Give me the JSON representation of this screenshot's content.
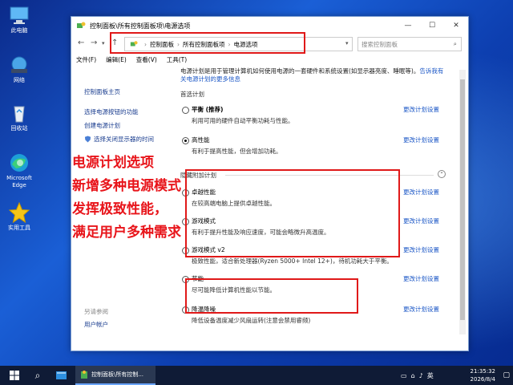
{
  "desktop": {
    "icons": [
      {
        "label": "此电脑"
      },
      {
        "label": "网络"
      },
      {
        "label": "回收站"
      },
      {
        "label": "Microsoft Edge"
      },
      {
        "label": "实用工具"
      }
    ]
  },
  "window": {
    "title": "控制面板\\所有控制面板项\\电源选项",
    "breadcrumb": [
      "控制面板",
      "所有控制面板项",
      "电源选项"
    ],
    "search_placeholder": "搜索控制面板",
    "menu": [
      "文件(F)",
      "编辑(E)",
      "查看(V)",
      "工具(T)"
    ],
    "sidebar": {
      "home": "控制面板主页",
      "items": [
        "选择电源按钮的功能",
        "创建电源计划",
        "选择关闭显示器的时间"
      ],
      "see_also": "另请参阅",
      "user_accounts": "用户帐户"
    },
    "intro_text": "电源计划是用于管理计算机如何使用电源的一套硬件和系统设置(如显示器亮度、睡眠等)。",
    "intro_link_1": "告诉我有",
    "intro_link_2": "关电源计划的更多信息",
    "preferred_heading": "首选计划",
    "hidden_heading": "隐藏附加计划",
    "change_label": "更改计划设置",
    "preferred_plans": [
      {
        "name": "平衡 (推荐)",
        "desc": "利用可用的硬件自动平衡功耗与性能。",
        "selected": false
      },
      {
        "name": "高性能",
        "desc": "有利于提高性能，但会增加功耗。",
        "selected": true
      }
    ],
    "hidden_plans": [
      {
        "name": "卓越性能",
        "desc": "在较高端电脑上提供卓越性能。"
      },
      {
        "name": "游戏模式",
        "desc": "有利于提升性能及响应速度，可能会略微升高温度。"
      },
      {
        "name": "游戏模式 v2",
        "desc": "极致性能，适合新处理器(Ryzen 5000+ Intel 12+)，待机功耗大于平衡。"
      },
      {
        "name": "节能",
        "desc": "尽可能降低计算机性能以节能。"
      },
      {
        "name": "降温降噪",
        "desc": "降低设备温度减少风扇运转(注意会禁用睿频)"
      }
    ]
  },
  "overlay_lines": [
    "电源计划选项",
    "新增多种电源模式",
    "发挥极致性能，",
    "满足用户多种需求"
  ],
  "taskbar": {
    "app_label": "控制面板\\所有控制...",
    "ime": "英",
    "time": "21:35:32",
    "date": "2026/8/4"
  },
  "colors": {
    "accent_red": "#e01919",
    "link_blue": "#1a56c6"
  }
}
